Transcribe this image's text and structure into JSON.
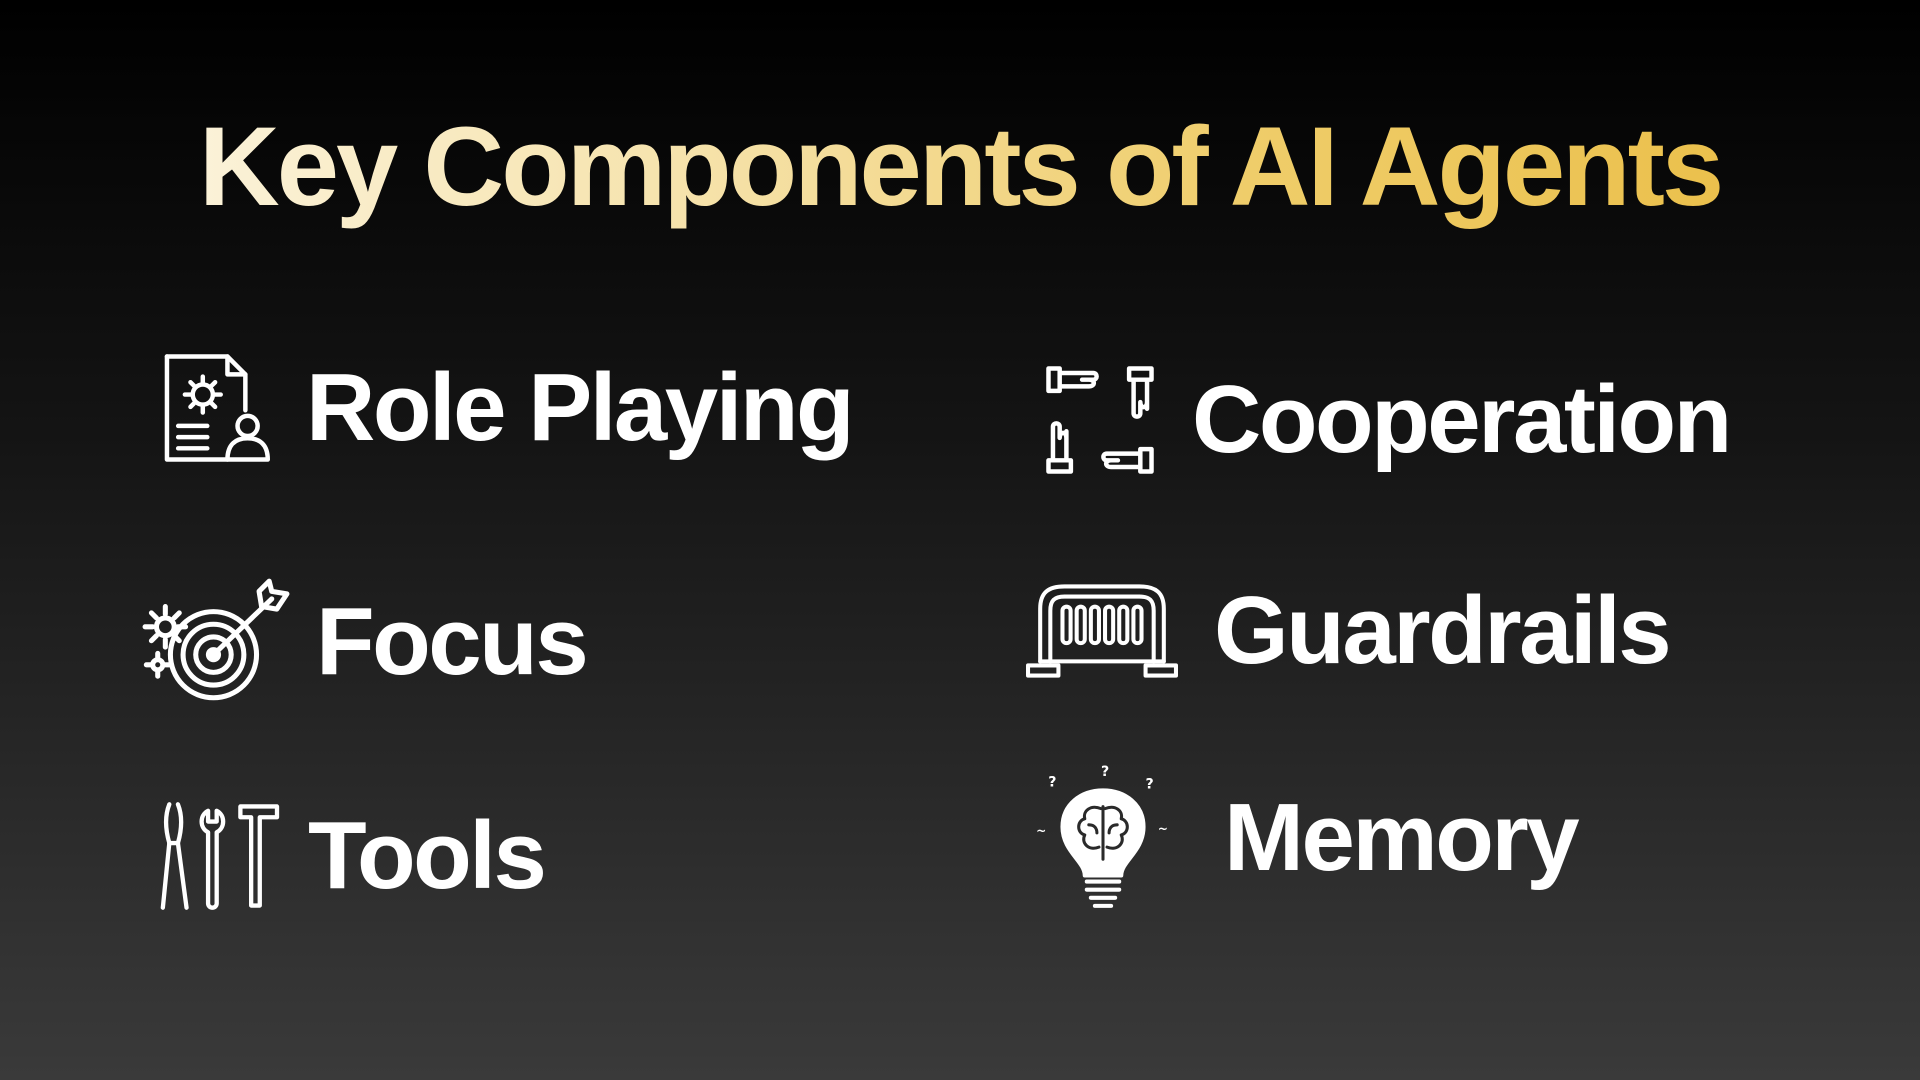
{
  "slide": {
    "title": "Key Components of AI Agents",
    "title_gradient": [
      "#fdf8ea",
      "#e9bb40"
    ],
    "background_gradient": [
      "#000000",
      "#3a3a3a"
    ]
  },
  "components": [
    {
      "label": "Role Playing",
      "icon": "document-gear-user-icon"
    },
    {
      "label": "Focus",
      "icon": "gear-target-arrow-icon"
    },
    {
      "label": "Tools",
      "icon": "pliers-wrench-hammer-icon"
    },
    {
      "label": "Cooperation",
      "icon": "four-hands-teamwork-icon"
    },
    {
      "label": "Guardrails",
      "icon": "barrier-fence-icon"
    },
    {
      "label": "Memory",
      "icon": "brain-lightbulb-icon"
    }
  ],
  "colors": {
    "label_text": "#ffffff",
    "icon_stroke": "#ffffff"
  }
}
